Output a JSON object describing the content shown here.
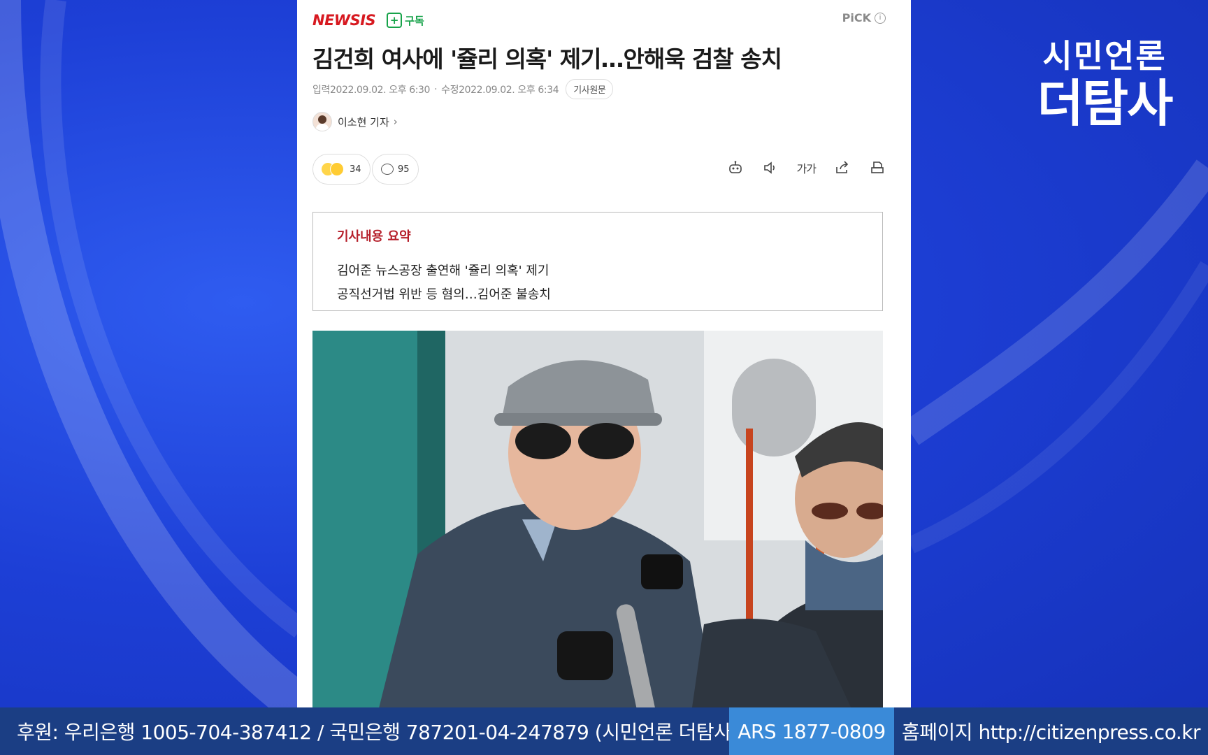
{
  "brand": {
    "name": "NEWSIS",
    "color": "#d71920"
  },
  "subscribe_label": "구독",
  "pick_label": "PiCK",
  "article": {
    "title": "김건희 여사에 '쥴리 의혹' 제기…안해욱 검찰 송치",
    "published": "입력2022.09.02. 오후 6:30",
    "modified": "수정2022.09.02. 오후 6:34",
    "original_link_label": "기사원문",
    "reporter": "이소현 기자",
    "reaction_count": "34",
    "comment_count": "95",
    "font_size_label": "가가",
    "summary": {
      "title": "기사내용 요약",
      "lines": [
        "김어준 뉴스공장 출연해 '쥴리 의혹' 제기",
        "공직선거법 위반 등 혐의…김어준 불송치"
      ]
    }
  },
  "channel": {
    "logo_line1": "시민언론",
    "logo_line2": "더탐사"
  },
  "ticker": {
    "sponsor": "후원: 우리은행 1005-704-387412 / 국민은행 787201-04-247879 (시민언론 더탐사)",
    "ars": "ARS 1877-0809",
    "homepage": "홈페이지 http://citizenpress.co.kr"
  }
}
